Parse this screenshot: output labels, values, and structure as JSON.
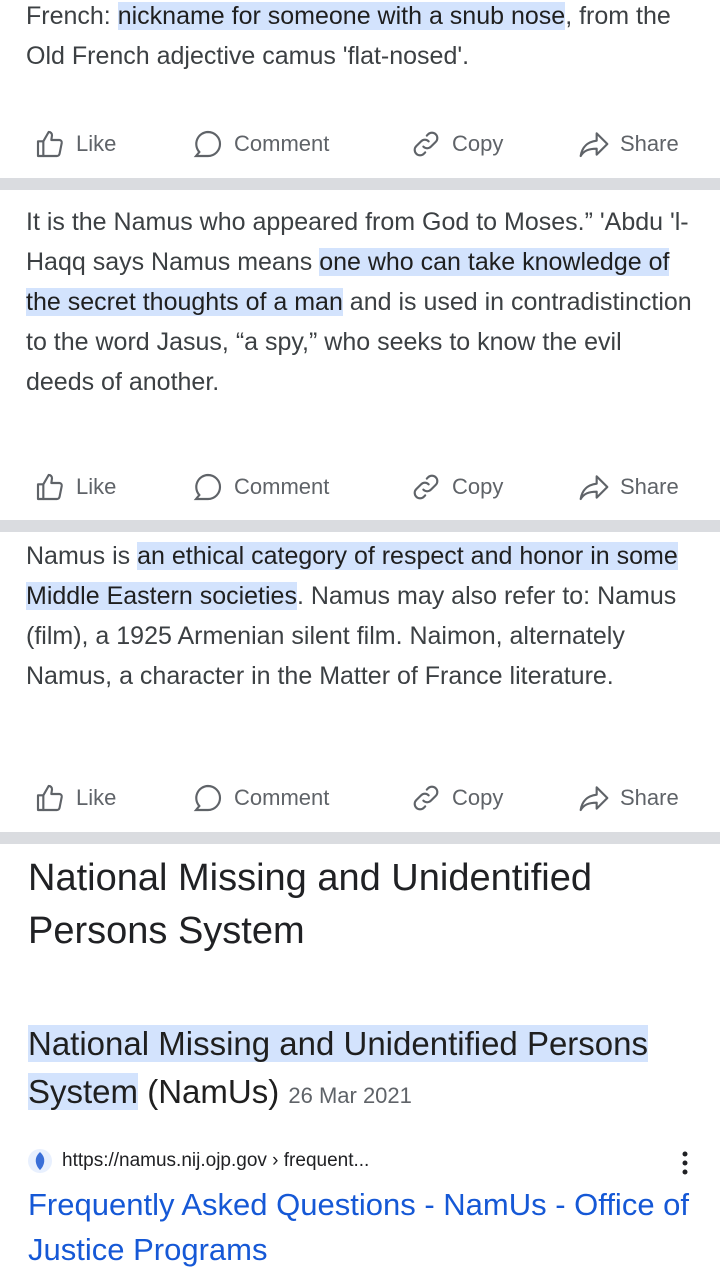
{
  "card1": {
    "pre": "French: ",
    "highlight": "nickname for someone with a snub nose",
    "post": ", from the Old French adjective camus 'flat-nosed'."
  },
  "card2": {
    "pre": "It is the Namus who appeared from God to Moses.” 'Abdu 'l-Haqq says Namus means ",
    "highlight": "one who can take knowledge of the secret thoughts of a man",
    "post": " and is used in contradistinction to the word Jasus, “a spy,” who seeks to know the evil deeds of another."
  },
  "card3": {
    "pre": "Namus is ",
    "highlight": "an ethical category of respect and honor in some Middle Eastern societies",
    "post": ". Namus may also refer to: Namus (film), a 1925 Armenian silent film. Naimon, alternately Namus, a character in the Matter of France literature."
  },
  "actions": {
    "like": "Like",
    "comment": "Comment",
    "copy": "Copy",
    "share": "Share"
  },
  "heading": "National Missing and Unidentified Persons System",
  "knowledge_panel": {
    "highlight": "National Missing and Unidentified Persons System",
    "suffix": " (NamUs)",
    "date": "26 Mar 2021"
  },
  "result": {
    "url": "https://namus.nij.ojp.gov › frequent...",
    "title": "Frequently Asked Questions - NamUs - Office of Justice Programs"
  },
  "colors": {
    "highlight": "#d3e3fd",
    "link": "#1558d6",
    "separator": "#dadce0"
  }
}
